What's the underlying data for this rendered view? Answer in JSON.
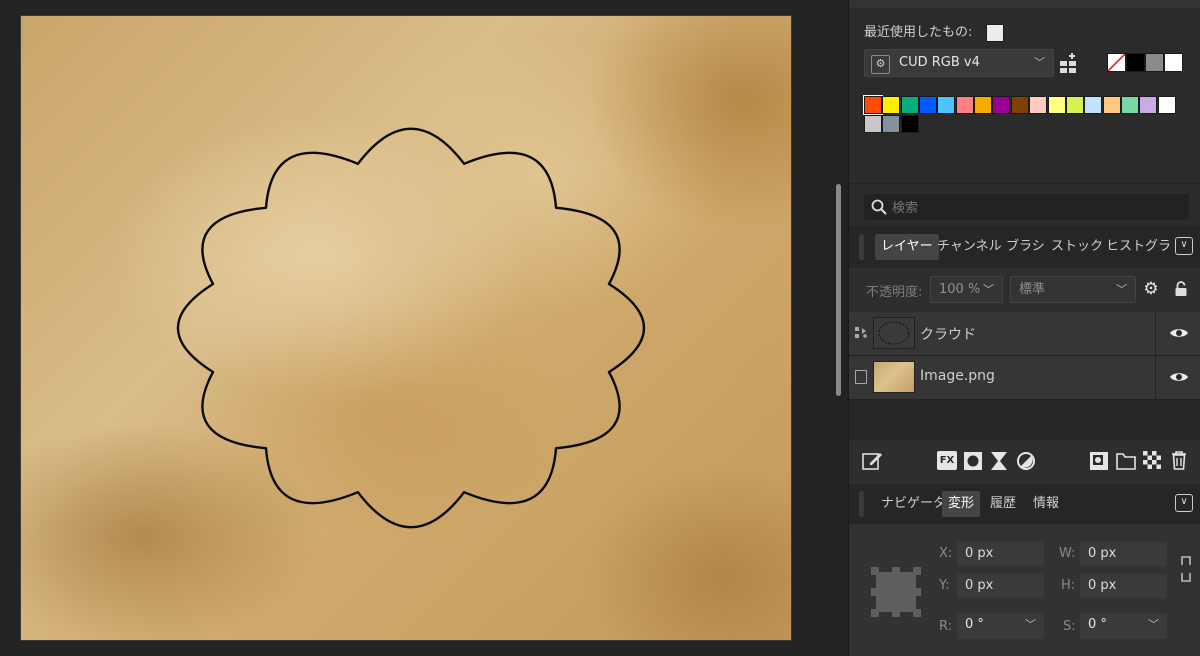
{
  "recent": {
    "label": "最近使用したもの:"
  },
  "palette": {
    "name": "CUD RGB v4",
    "top_swatches": [
      "none",
      "#000000",
      "#8a8a8a",
      "#ffffff"
    ],
    "colors": [
      "#ff4b00",
      "#fff100",
      "#03af7a",
      "#005aff",
      "#4dc4ff",
      "#ff8082",
      "#f6aa00",
      "#990099",
      "#804000",
      "#ffcabf",
      "#ffff80",
      "#d8f255",
      "#bfe4ff",
      "#ffca80",
      "#77d9a8",
      "#c9ace6",
      "#ffffff",
      "#c8c8cb",
      "#84919e",
      "#000000"
    ]
  },
  "search": {
    "placeholder": "検索"
  },
  "layers_tabs": [
    {
      "label": "レイヤー"
    },
    {
      "label": "チャンネル"
    },
    {
      "label": "ブラシ"
    },
    {
      "label": "ストック"
    },
    {
      "label": "ヒストグラ"
    }
  ],
  "layer_controls": {
    "opacity_label": "不透明度:",
    "opacity_value": "100 %",
    "blend_mode": "標準"
  },
  "layers": [
    {
      "name": "クラウド"
    },
    {
      "name": "Image.png"
    }
  ],
  "bottom_tabs": [
    {
      "label": "ナビゲータ"
    },
    {
      "label": "変形"
    },
    {
      "label": "履歴"
    },
    {
      "label": "情報"
    }
  ],
  "transform": {
    "x_label": "X:",
    "x_value": "0 px",
    "y_label": "Y:",
    "y_value": "0 px",
    "w_label": "W:",
    "w_value": "0 px",
    "h_label": "H:",
    "h_value": "0 px",
    "r_label": "R:",
    "r_value": "0 °",
    "s_label": "S:",
    "s_value": "0 °"
  }
}
